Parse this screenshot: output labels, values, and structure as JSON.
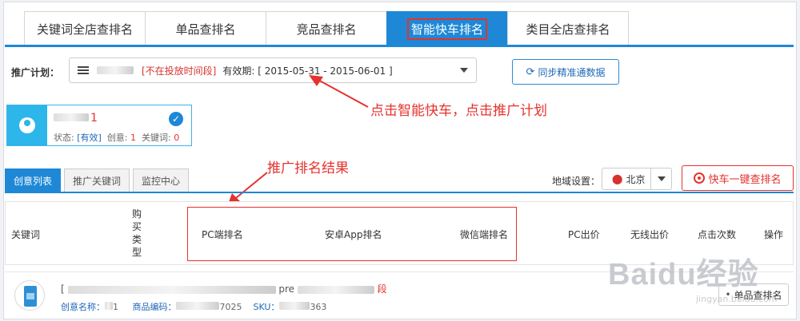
{
  "tabs": [
    {
      "label": "关键词全店查排名"
    },
    {
      "label": "单品查排名"
    },
    {
      "label": "竞品查排名"
    },
    {
      "label": "智能快车排名"
    },
    {
      "label": "类目全店查排名"
    }
  ],
  "plan": {
    "label": "推广计划：",
    "status": "[不在投放时间段]",
    "validity": "有效期: [ 2015-05-31 - 2015-06-01 ]"
  },
  "sync_button": "同步精准通数据",
  "annotations": {
    "click_hint": "点击智能快车，点击推广计划",
    "result_hint": "推广排名结果"
  },
  "card": {
    "name_suffix": "1",
    "status_label": "状态:",
    "status_value": "[有效]",
    "creative_label": "创意:",
    "creative_value": "1",
    "keyword_label": "关键词:",
    "keyword_value": "0"
  },
  "subtabs": [
    {
      "label": "创意列表"
    },
    {
      "label": "推广关键词"
    },
    {
      "label": "监控中心"
    }
  ],
  "region": {
    "label": "地域设置：",
    "value": "北京"
  },
  "quick_button": "快车一键查排名",
  "table": {
    "headers": {
      "keyword": "关键词",
      "buy_type": "购买类型",
      "pc_rank": "PC端排名",
      "android_rank": "安卓App排名",
      "wechat_rank": "微信端排名",
      "pc_bid": "PC出价",
      "wireless_bid": "无线出价",
      "clicks": "点击次数",
      "action": "操作"
    }
  },
  "product": {
    "title_visible_a": "[",
    "title_visible_b": "pre",
    "title_red": "段",
    "creative_label": "创意名称：",
    "creative_value": "1",
    "code_label": "商品编码：",
    "code_value": "7025",
    "sku_label": "SKU：",
    "sku_value": "363",
    "button": "单品查排名"
  },
  "watermark": {
    "main": "Baidu经验",
    "sub": "jingyan.baidu.com"
  }
}
